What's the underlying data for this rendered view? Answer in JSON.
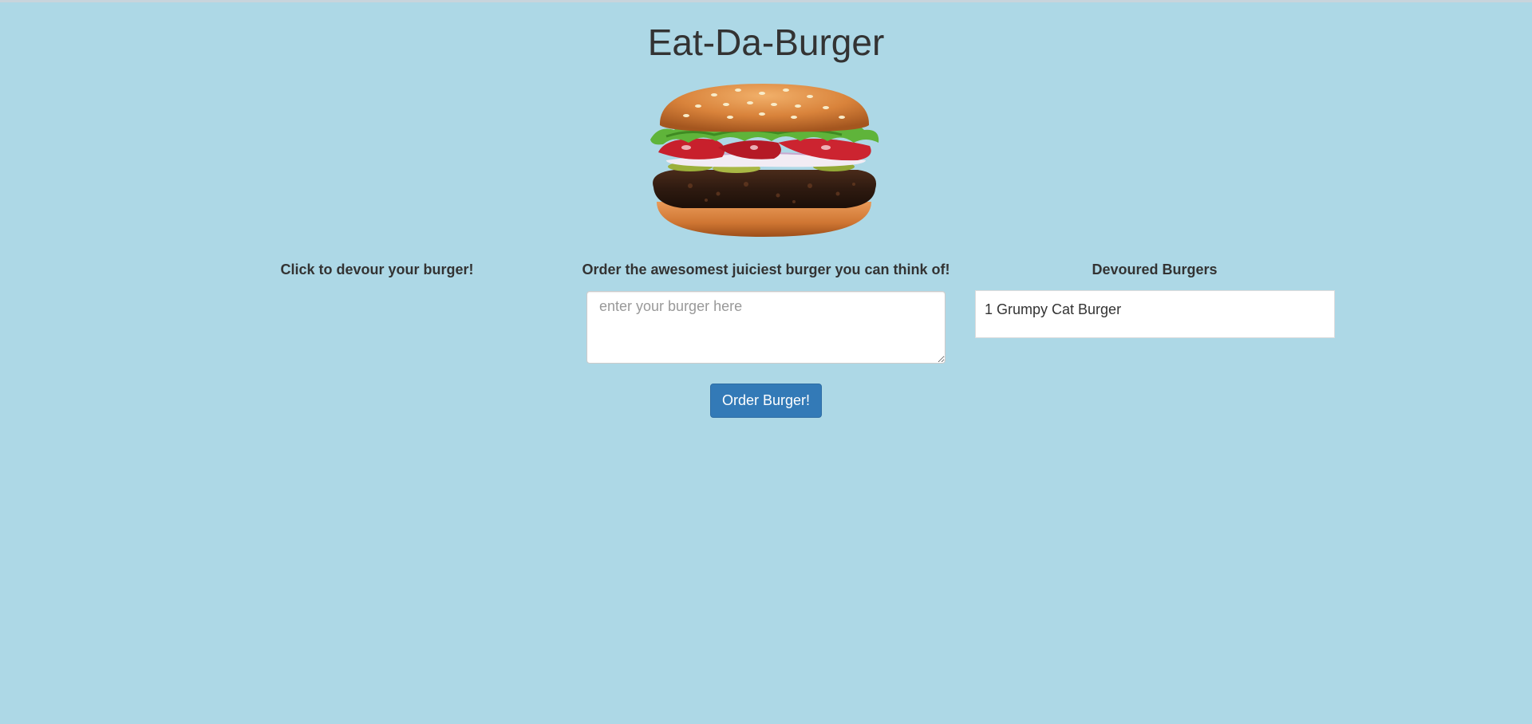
{
  "page": {
    "title": "Eat-Da-Burger",
    "background_color": "#add8e6"
  },
  "hero": {
    "image": "burger-image"
  },
  "columns": {
    "undevoured": {
      "heading": "Click to devour your burger!",
      "items": []
    },
    "order": {
      "heading": "Order the awesomest juiciest burger you can think of!",
      "input": {
        "value": "",
        "placeholder": "enter your burger here"
      },
      "button_label": "Order Burger!",
      "button_color": "#337ab7"
    },
    "devoured": {
      "heading": "Devoured Burgers",
      "items": [
        {
          "label": "1 Grumpy Cat Burger"
        }
      ]
    }
  }
}
